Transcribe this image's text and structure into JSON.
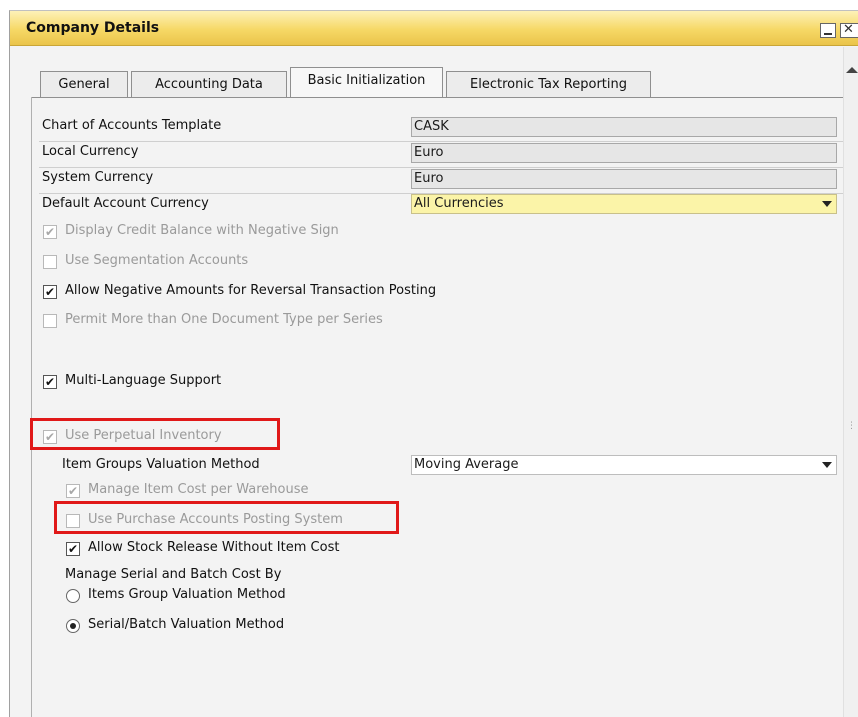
{
  "window": {
    "title": "Company Details",
    "minimize_icon": "minimize-icon",
    "close_icon": "close-icon",
    "close_glyph": "✕"
  },
  "tabs": [
    {
      "label": "General",
      "active": false
    },
    {
      "label": "Accounting Data",
      "active": false
    },
    {
      "label": "Basic Initialization",
      "active": true
    },
    {
      "label": "Electronic Tax Reporting",
      "active": false
    }
  ],
  "fields": {
    "chart_template": {
      "label": "Chart of Accounts Template",
      "value": "CASK"
    },
    "local_currency": {
      "label": "Local Currency",
      "value": "Euro"
    },
    "system_currency": {
      "label": "System Currency",
      "value": "Euro"
    },
    "default_currency": {
      "label": "Default Account Currency",
      "value": "All Currencies"
    }
  },
  "checkboxes": {
    "credit_negative": {
      "label": "Display Credit Balance with Negative Sign",
      "checked": true,
      "enabled": false
    },
    "segmentation": {
      "label": "Use Segmentation Accounts",
      "checked": false,
      "enabled": false
    },
    "negative_reversal": {
      "label": "Allow Negative Amounts for Reversal Transaction Posting",
      "checked": true,
      "enabled": true
    },
    "doc_type_series": {
      "label": "Permit More than One Document Type per Series",
      "checked": false,
      "enabled": false
    },
    "multi_language": {
      "label": "Multi-Language Support",
      "checked": true,
      "enabled": true
    },
    "perpetual_inventory": {
      "label": "Use Perpetual Inventory",
      "checked": true,
      "enabled": false
    },
    "cost_per_warehouse": {
      "label": "Manage Item Cost per Warehouse",
      "checked": true,
      "enabled": false
    },
    "purchase_accounts": {
      "label": "Use Purchase Accounts Posting System",
      "checked": false,
      "enabled": false
    },
    "stock_release": {
      "label": "Allow Stock Release Without Item Cost",
      "checked": true,
      "enabled": true
    }
  },
  "valuation": {
    "label": "Item Groups Valuation Method",
    "value": "Moving Average"
  },
  "serial_batch": {
    "label": "Manage Serial and Batch Cost By",
    "options": [
      {
        "label": "Items Group Valuation Method",
        "selected": false
      },
      {
        "label": "Serial/Batch Valuation Method",
        "selected": true
      }
    ]
  },
  "check_glyph": "✔",
  "colors": {
    "title_bar": "#f6d866",
    "highlight": "#e01818",
    "yellow_field": "#fbf4a8"
  }
}
